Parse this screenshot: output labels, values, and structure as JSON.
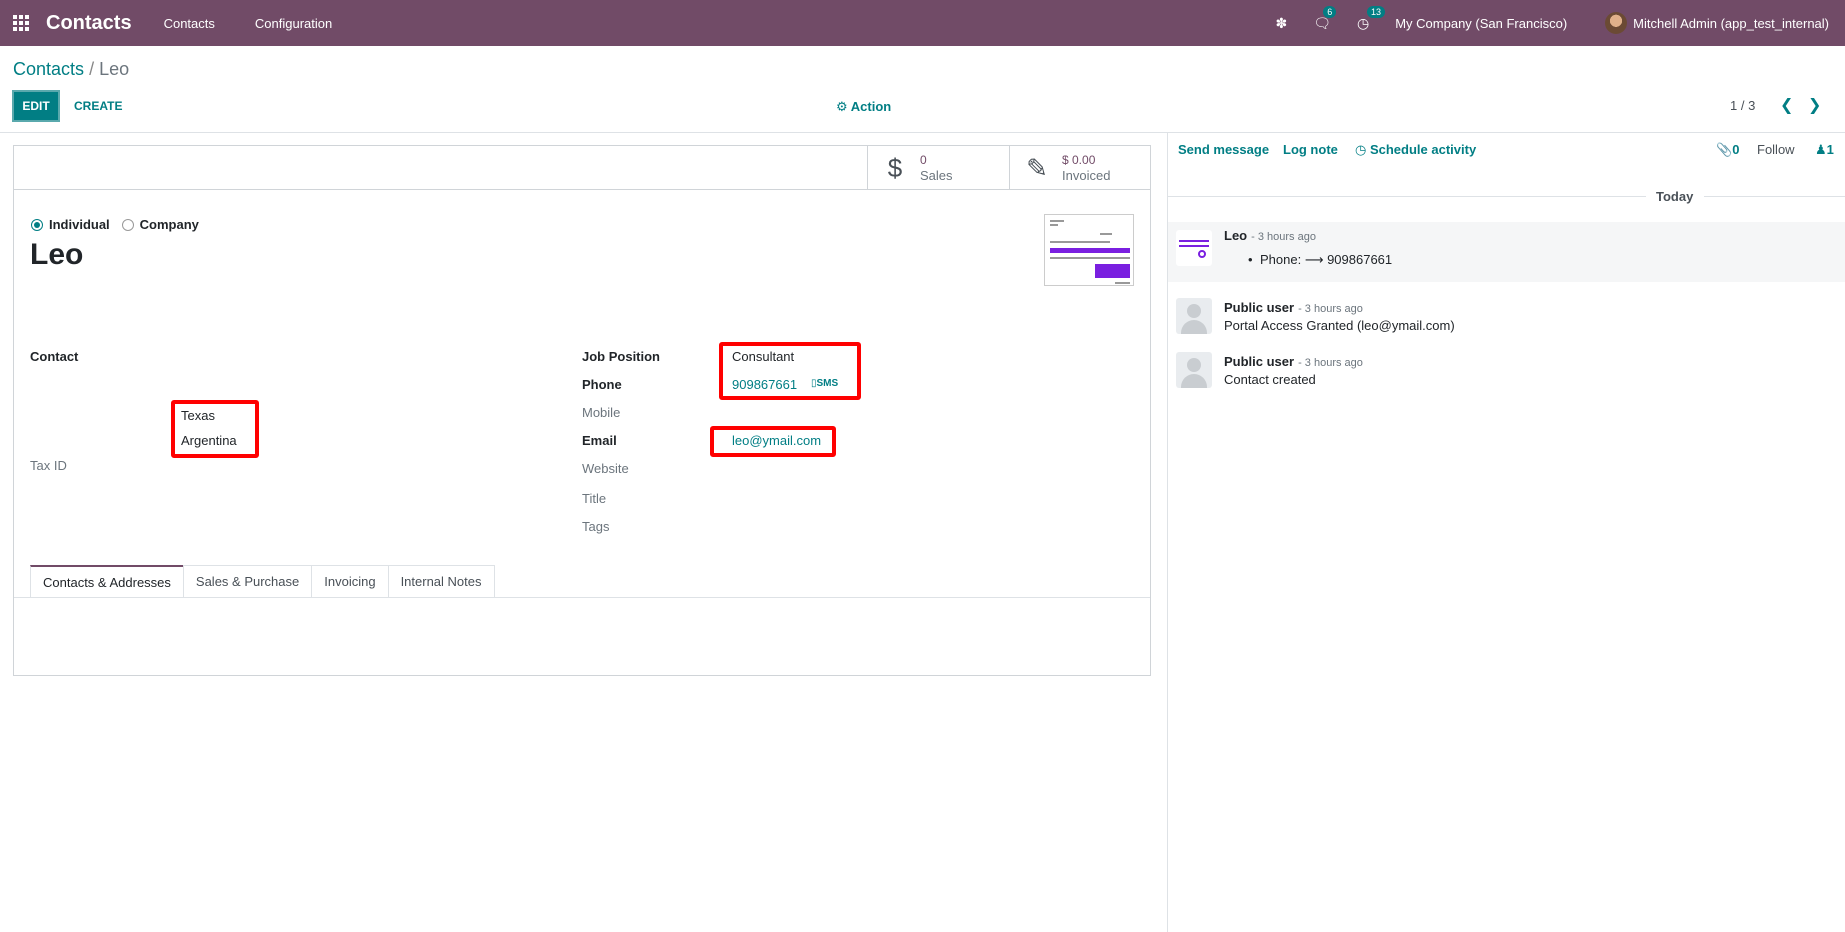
{
  "navbar": {
    "app_name": "Contacts",
    "menus": [
      "Contacts",
      "Configuration"
    ],
    "messages_badge": "6",
    "activities_badge": "13",
    "company": "My Company (San Francisco)",
    "user": "Mitchell Admin (app_test_internal)",
    "bg_color": "#714B67"
  },
  "breadcrumb": {
    "parent": "Contacts",
    "separator": "/",
    "current": "Leo"
  },
  "control_panel": {
    "edit_label": "EDIT",
    "create_label": "CREATE",
    "action_label": "Action",
    "pager": "1 / 3"
  },
  "stats": {
    "sales_value": "0",
    "sales_label": "Sales",
    "invoiced_value": "$ 0.00",
    "invoiced_label": "Invoiced"
  },
  "company_type": {
    "individual": "Individual",
    "company": "Company",
    "selected": "individual"
  },
  "partner_name": "Leo",
  "left_fields": {
    "contact_label": "Contact",
    "state": "Texas",
    "country": "Argentina",
    "tax_id_label": "Tax ID"
  },
  "right_fields": {
    "job_position_label": "Job Position",
    "job_position": "Consultant",
    "phone_label": "Phone",
    "phone": "909867661",
    "sms_label": "SMS",
    "mobile_label": "Mobile",
    "email_label": "Email",
    "email": "leo@ymail.com",
    "website_label": "Website",
    "title_label": "Title",
    "tags_label": "Tags"
  },
  "tabs": [
    "Contacts & Addresses",
    "Sales & Purchase",
    "Invoicing",
    "Internal Notes"
  ],
  "chatter": {
    "send_message": "Send message",
    "log_note": "Log note",
    "schedule_activity": "Schedule activity",
    "attachments": "0",
    "follow": "Follow",
    "followers": "1",
    "today": "Today",
    "messages": [
      {
        "author": "Leo",
        "time": "- 3 hours ago",
        "change": "Phone: ⟶ 909867661"
      },
      {
        "author": "Public user",
        "time": "- 3 hours ago",
        "body": "Portal Access Granted (leo@ymail.com)"
      },
      {
        "author": "Public user",
        "time": "- 3 hours ago",
        "body": "Contact created"
      }
    ]
  },
  "colors": {
    "accent": "#017e84",
    "brand": "#714B67",
    "highlight": "#ff0000"
  }
}
